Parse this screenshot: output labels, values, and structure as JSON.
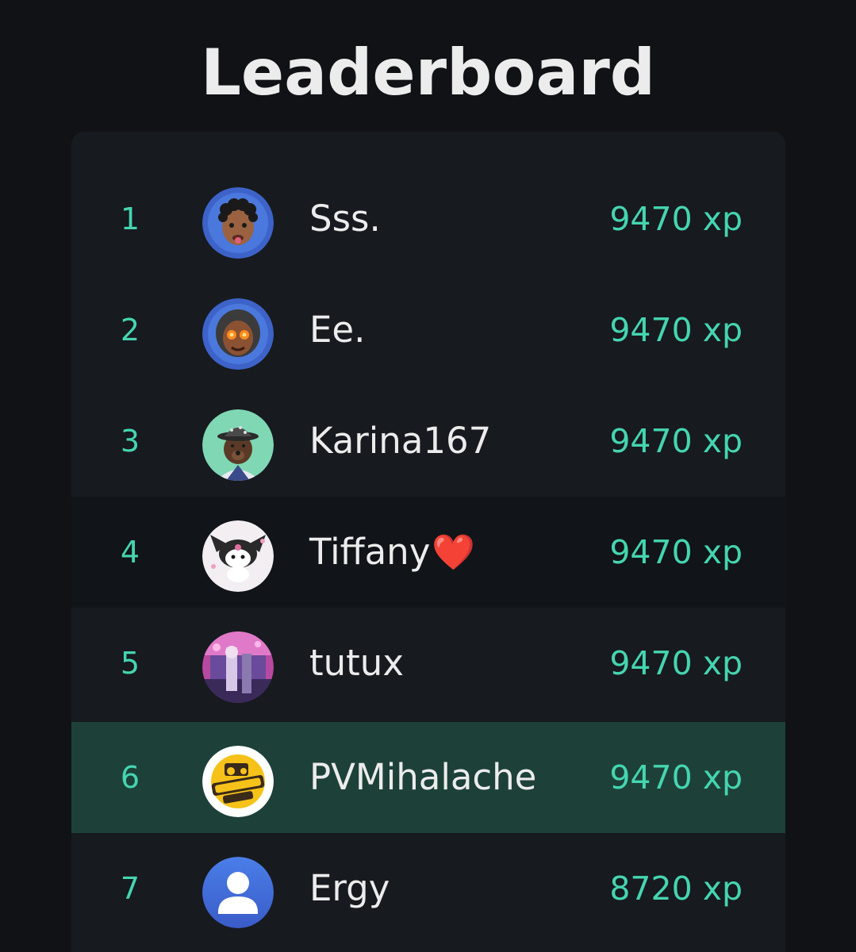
{
  "header": {
    "title": "Leaderboard"
  },
  "leaderboard": {
    "rows": [
      {
        "rank": "1",
        "name": "Sss.",
        "score": "9470 xp",
        "avatar": "memoji-curly-hair-icon"
      },
      {
        "rank": "2",
        "name": "Ee.",
        "score": "9470 xp",
        "avatar": "memoji-glowing-eyes-icon"
      },
      {
        "rank": "3",
        "name": "Karina167",
        "score": "9470 xp",
        "avatar": "bear-bucket-hat-icon"
      },
      {
        "rank": "4",
        "name": "Tiffany",
        "name_suffix": "❤️",
        "score": "9470 xp",
        "avatar": "kuromi-icon"
      },
      {
        "rank": "5",
        "name": "tutux",
        "score": "9470 xp",
        "avatar": "anime-art-icon"
      },
      {
        "rank": "6",
        "name": "PVMihalache",
        "score": "9470 xp",
        "avatar": "humble-tractors-logo-icon",
        "highlighted": true
      },
      {
        "rank": "7",
        "name": "Ergy",
        "score": "8720 xp",
        "avatar": "default-user-icon"
      }
    ]
  },
  "colors": {
    "background": "#101216",
    "panel": "#171a1f",
    "highlight_row": "#1d4138",
    "accent_teal": "#45d5b0",
    "text": "#ececec",
    "heart": "#e0202c"
  }
}
